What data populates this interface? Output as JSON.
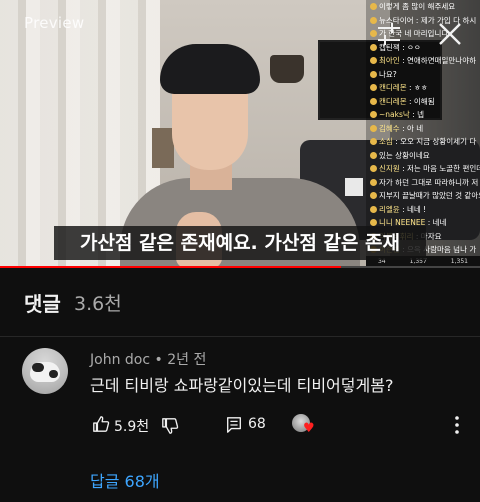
{
  "video": {
    "watermark": "Preview",
    "subtitle": "가산점 같은 존재예요. 가산점 같은 존재",
    "progress_fraction": 0.71,
    "chat": [
      {
        "name": "",
        "text": "이렇게 좀 많이 해주세요"
      },
      {
        "name": "",
        "text": "뉴스타이어 : 제가 가입 다 하시"
      },
      {
        "name": "",
        "text": "가 한국 네 마리입니다"
      },
      {
        "name": "",
        "text": "캡틴잭 : ㅇㅇ"
      },
      {
        "name": "최아인",
        "text": "연애하면매일만나야하"
      },
      {
        "name": "",
        "text": "나요?"
      },
      {
        "name": "캔디레몬",
        "text": "ㅎㅎ"
      },
      {
        "name": "캔디레몬",
        "text": "이해됨"
      },
      {
        "name": "~naks낙",
        "text": "넵"
      },
      {
        "name": "김혜수",
        "text": "아 네"
      },
      {
        "name": "소심",
        "text": "오오 지금 상황이세기 다"
      },
      {
        "name": "",
        "text": "있는 상황이네요"
      },
      {
        "name": "신지원",
        "text": "저는 마음 노골한 편인데"
      },
      {
        "name": "",
        "text": "자가 하던 그대로 따라하니까 저 호"
      },
      {
        "name": "",
        "text": "지부지 끝날때가 많았던 것 같아요"
      },
      {
        "name": "리엘윤",
        "text": "네네 !"
      },
      {
        "name": "니니 NEENEE",
        "text": "네네"
      },
      {
        "name": "러블리휘리",
        "text": "마자요"
      },
      {
        "name": "이슨빈",
        "text": "으윽 사람마음 넘나 가"
      }
    ],
    "chat_footer": [
      "34",
      "1,357",
      "1,351"
    ]
  },
  "header": {
    "title": "댓글",
    "count": "3.6천"
  },
  "comment": {
    "author": "John doc",
    "age": "2년 전",
    "meta_separator": " • ",
    "text": "근데 티비랑 쇼파랑같이있는데 티비어덯게봄?",
    "like_count": "5.9천",
    "reply_count": "68",
    "replies_link": "답글 68개"
  },
  "icons": {
    "filter": "sliders-icon",
    "close": "close-icon",
    "like": "thumbs-up-icon",
    "dislike": "thumbs-down-icon",
    "reply": "comment-icon",
    "creator_heart": "heart-icon",
    "more": "more-vert-icon"
  },
  "colors": {
    "background": "#0f0f0f",
    "link": "#3ea6ff",
    "heart": "#ff2020",
    "progress": "#ff0000"
  }
}
